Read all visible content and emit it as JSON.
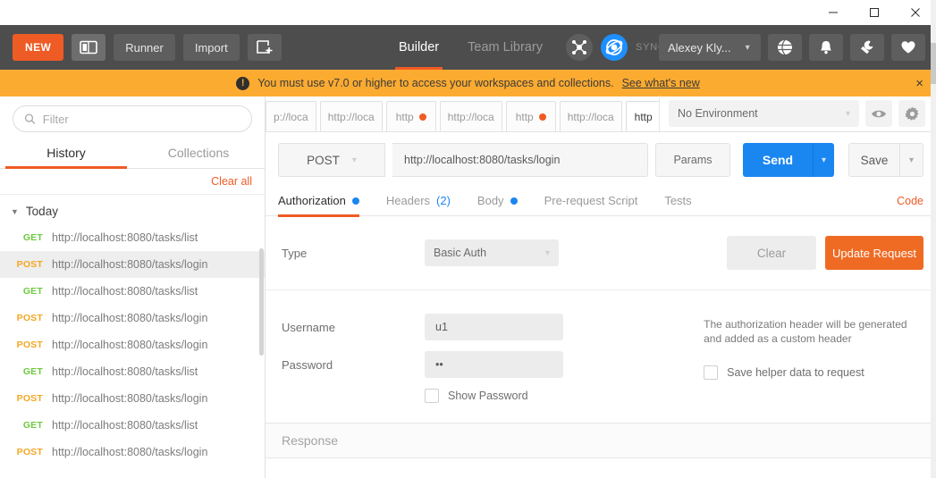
{
  "window": {
    "minimize_label": "minimize-window",
    "maximize_label": "maximize-window",
    "close_label": "close-window"
  },
  "toolbar": {
    "new_label": "NEW",
    "sidebar_toggle_label": "layout-toggle",
    "runner_label": "Runner",
    "import_label": "Import",
    "new_window_label": "new-window",
    "nav_tabs": [
      {
        "label": "Builder",
        "active": true
      },
      {
        "label": "Team Library",
        "active": false
      }
    ],
    "sync_status": "SYNCING",
    "user_name": "Alexey Kly...",
    "icons": {
      "globe": "globe-icon",
      "bell": "bell-icon",
      "wrench": "wrench-icon",
      "heart": "heart-icon"
    },
    "accent_orange": "#ef5b25"
  },
  "banner": {
    "icon": "exclamation-icon",
    "message": "You must use v7.0 or higher to access your workspaces and collections.",
    "link_text": "See what's new",
    "close_label": "×",
    "background": "#fcab31"
  },
  "sidebar": {
    "filter_placeholder": "Filter",
    "filter_value": "",
    "tabs": [
      {
        "label": "History",
        "active": true
      },
      {
        "label": "Collections",
        "active": false
      }
    ],
    "clear_all_label": "Clear all",
    "group_label": "Today",
    "items": [
      {
        "method": "GET",
        "url": "http://localhost:8080/tasks/list",
        "selected": false
      },
      {
        "method": "POST",
        "url": "http://localhost:8080/tasks/login",
        "selected": true
      },
      {
        "method": "GET",
        "url": "http://localhost:8080/tasks/list",
        "selected": false
      },
      {
        "method": "POST",
        "url": "http://localhost:8080/tasks/login",
        "selected": false
      },
      {
        "method": "POST",
        "url": "http://localhost:8080/tasks/login",
        "selected": false
      },
      {
        "method": "GET",
        "url": "http://localhost:8080/tasks/list",
        "selected": false
      },
      {
        "method": "POST",
        "url": "http://localhost:8080/tasks/login",
        "selected": false
      },
      {
        "method": "GET",
        "url": "http://localhost:8080/tasks/list",
        "selected": false
      },
      {
        "method": "POST",
        "url": "http://localhost:8080/tasks/login",
        "selected": false
      }
    ]
  },
  "request_tabs": [
    {
      "label": "p://loca",
      "dirty": false,
      "active": false,
      "closable": false
    },
    {
      "label": "http://loca",
      "dirty": false,
      "active": false,
      "closable": false
    },
    {
      "label": "http",
      "dirty": true,
      "active": false,
      "closable": false
    },
    {
      "label": "http://loca",
      "dirty": false,
      "active": false,
      "closable": false
    },
    {
      "label": "http",
      "dirty": true,
      "active": false,
      "closable": false
    },
    {
      "label": "http://loca",
      "dirty": false,
      "active": false,
      "closable": false
    },
    {
      "label": "http",
      "dirty": false,
      "active": true,
      "closable": true
    }
  ],
  "environment": {
    "selected": "No Environment",
    "eye_icon": "eye-icon",
    "gear_icon": "gear-icon"
  },
  "request": {
    "method": "POST",
    "url": "http://localhost:8080/tasks/login",
    "params_label": "Params",
    "send_label": "Send",
    "save_label": "Save"
  },
  "req_subtabs": [
    {
      "label": "Authorization",
      "badge": "dot",
      "active": true
    },
    {
      "label": "Headers",
      "badge": "(2)",
      "active": false
    },
    {
      "label": "Body",
      "badge": "dot",
      "active": false
    },
    {
      "label": "Pre-request Script",
      "badge": "",
      "active": false
    },
    {
      "label": "Tests",
      "badge": "",
      "active": false
    }
  ],
  "code_link": "Code",
  "auth": {
    "type_label": "Type",
    "type_value": "Basic Auth",
    "clear_label": "Clear",
    "update_label": "Update Request",
    "username_label": "Username",
    "username_value": "u1",
    "password_label": "Password",
    "password_value": "••",
    "show_password_label": "Show Password",
    "show_password_checked": false,
    "helper_text": "The authorization header will be generated and added as a custom header",
    "save_helper_label": "Save helper data to request",
    "save_helper_checked": false
  },
  "response": {
    "title": "Response"
  }
}
